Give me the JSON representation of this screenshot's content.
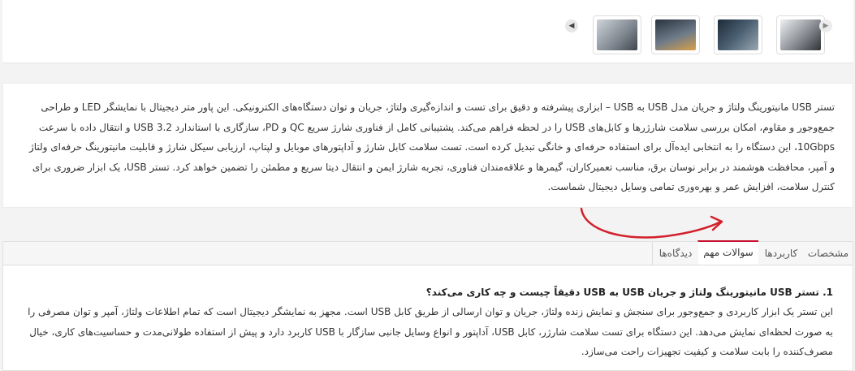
{
  "gallery": {
    "thumbs": [
      {
        "alt": "thumb-1",
        "colors": [
          "#cfd4da",
          "#5f6770"
        ]
      },
      {
        "alt": "thumb-2",
        "colors": [
          "#2a3340",
          "#6e7b88"
        ]
      },
      {
        "alt": "thumb-3",
        "colors": [
          "#3a2f26",
          "#d8a04a"
        ]
      },
      {
        "alt": "thumb-4",
        "colors": [
          "#8a8e93",
          "#2f3338"
        ]
      }
    ],
    "prev_icon": "◀",
    "next_icon": "▶"
  },
  "description": {
    "text": "تستر USB مانیتورینگ ولتاژ و جریان مدل USB به USB – ابزاری پیشرفته و دقیق برای تست و اندازه‌گیری ولتاژ، جریان و توان دستگاه‌های الکترونیکی. این پاور متر دیجیتال با نمایشگر LED و طراحی جمع‌وجور و مقاوم، امکان بررسی سلامت شارژرها و کابل‌های USB را در لحظه فراهم می‌کند. پشتیبانی کامل از فناوری شارژ سریع QC و PD، سازگاری با استاندارد USB 3.2 و انتقال داده با سرعت 10Gbps، این دستگاه را به انتخابی ایده‌آل برای استفاده حرفه‌ای و خانگی تبدیل کرده است. تست سلامت کابل شارژ و آداپتورهای موبایل و لپتاپ، ارزیابی سیکل شارژ و قابلیت مانیتورینگ حرفه‌ای ولتاژ و آمپر، محافظت هوشمند در برابر نوسان برق، مناسب تعمیرکاران، گیمرها و علاقه‌مندان فناوری، تجربه شارژ ایمن و انتقال دیتا سریع و مطمئن را تضمین خواهد کرد. تستر USB، یک ابزار ضروری برای کنترل سلامت، افزایش عمر و بهره‌وری تمامی وسایل دیجیتال شماست."
  },
  "tabs": {
    "items": [
      {
        "label": "مشخصات"
      },
      {
        "label": "کاربردها"
      },
      {
        "label": "سوالات مهم"
      },
      {
        "label": "دیدگاه‌ها"
      }
    ],
    "active_index": 2
  },
  "faq": {
    "question": "1. تستر USB مانیتورینگ ولتاژ و جریان USB به USB دقیقاً چیست و چه کاری می‌کند؟",
    "answer": "این تستر یک ابزار کاربردی و جمع‌وجور برای سنجش و نمایش زنده ولتاژ، جریان و توان ارسالی از طریق کابل USB است. مجهز به نمایشگر دیجیتال است که تمام اطلاعات ولتاژ، آمپر و توان مصرفی را به صورت لحظه‌ای نمایش می‌دهد. این دستگاه برای تست سلامت شارژر، کابل USB، آداپتور و انواع وسایل جانبی سازگار با USB کاربرد دارد و پیش از استفاده طولانی‌مدت و حساسیت‌های کاری، خیال مصرف‌کننده را بابت سلامت و کیفیت تجهیزات راحت می‌سازد."
  },
  "colors": {
    "accent": "#c8102e",
    "annotation_arrow": "#d21f2a"
  }
}
